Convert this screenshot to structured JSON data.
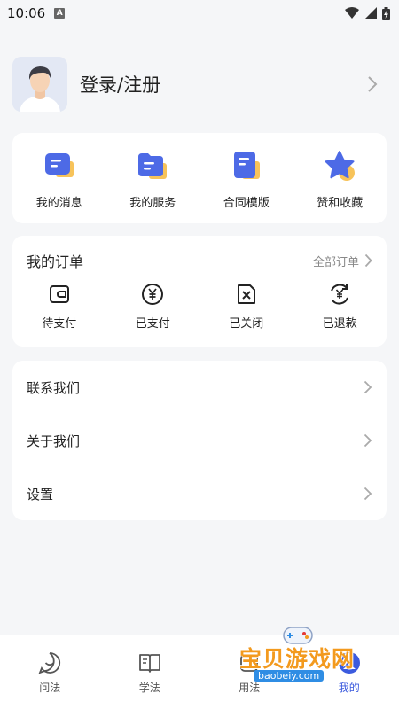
{
  "status_bar": {
    "time": "10:06",
    "a_badge": "A"
  },
  "profile": {
    "login_label": "登录/注册"
  },
  "quick_actions": [
    {
      "label": "我的消息",
      "icon": "message-icon"
    },
    {
      "label": "我的服务",
      "icon": "folder-icon"
    },
    {
      "label": "合同模版",
      "icon": "document-icon"
    },
    {
      "label": "赞和收藏",
      "icon": "star-icon"
    }
  ],
  "orders": {
    "title": "我的订单",
    "all_label": "全部订单",
    "items": [
      {
        "label": "待支付",
        "icon": "wallet-icon"
      },
      {
        "label": "已支付",
        "icon": "yen-circle-icon"
      },
      {
        "label": "已关闭",
        "icon": "closed-box-icon"
      },
      {
        "label": "已退款",
        "icon": "refund-icon"
      }
    ]
  },
  "menu": [
    {
      "label": "联系我们"
    },
    {
      "label": "关于我们"
    },
    {
      "label": "设置"
    }
  ],
  "tabbar": [
    {
      "label": "问法",
      "icon": "chat-bubble-icon"
    },
    {
      "label": "学法",
      "icon": "book-icon"
    },
    {
      "label": "用法",
      "icon": "use-icon"
    },
    {
      "label": "我的",
      "icon": "user-icon"
    }
  ],
  "watermark": {
    "text": "宝贝游戏网",
    "url": "baobeiy.com"
  },
  "colors": {
    "accent": "#3c5bde",
    "background": "#f5f6f8",
    "icon_yellow": "#f7c35a"
  }
}
